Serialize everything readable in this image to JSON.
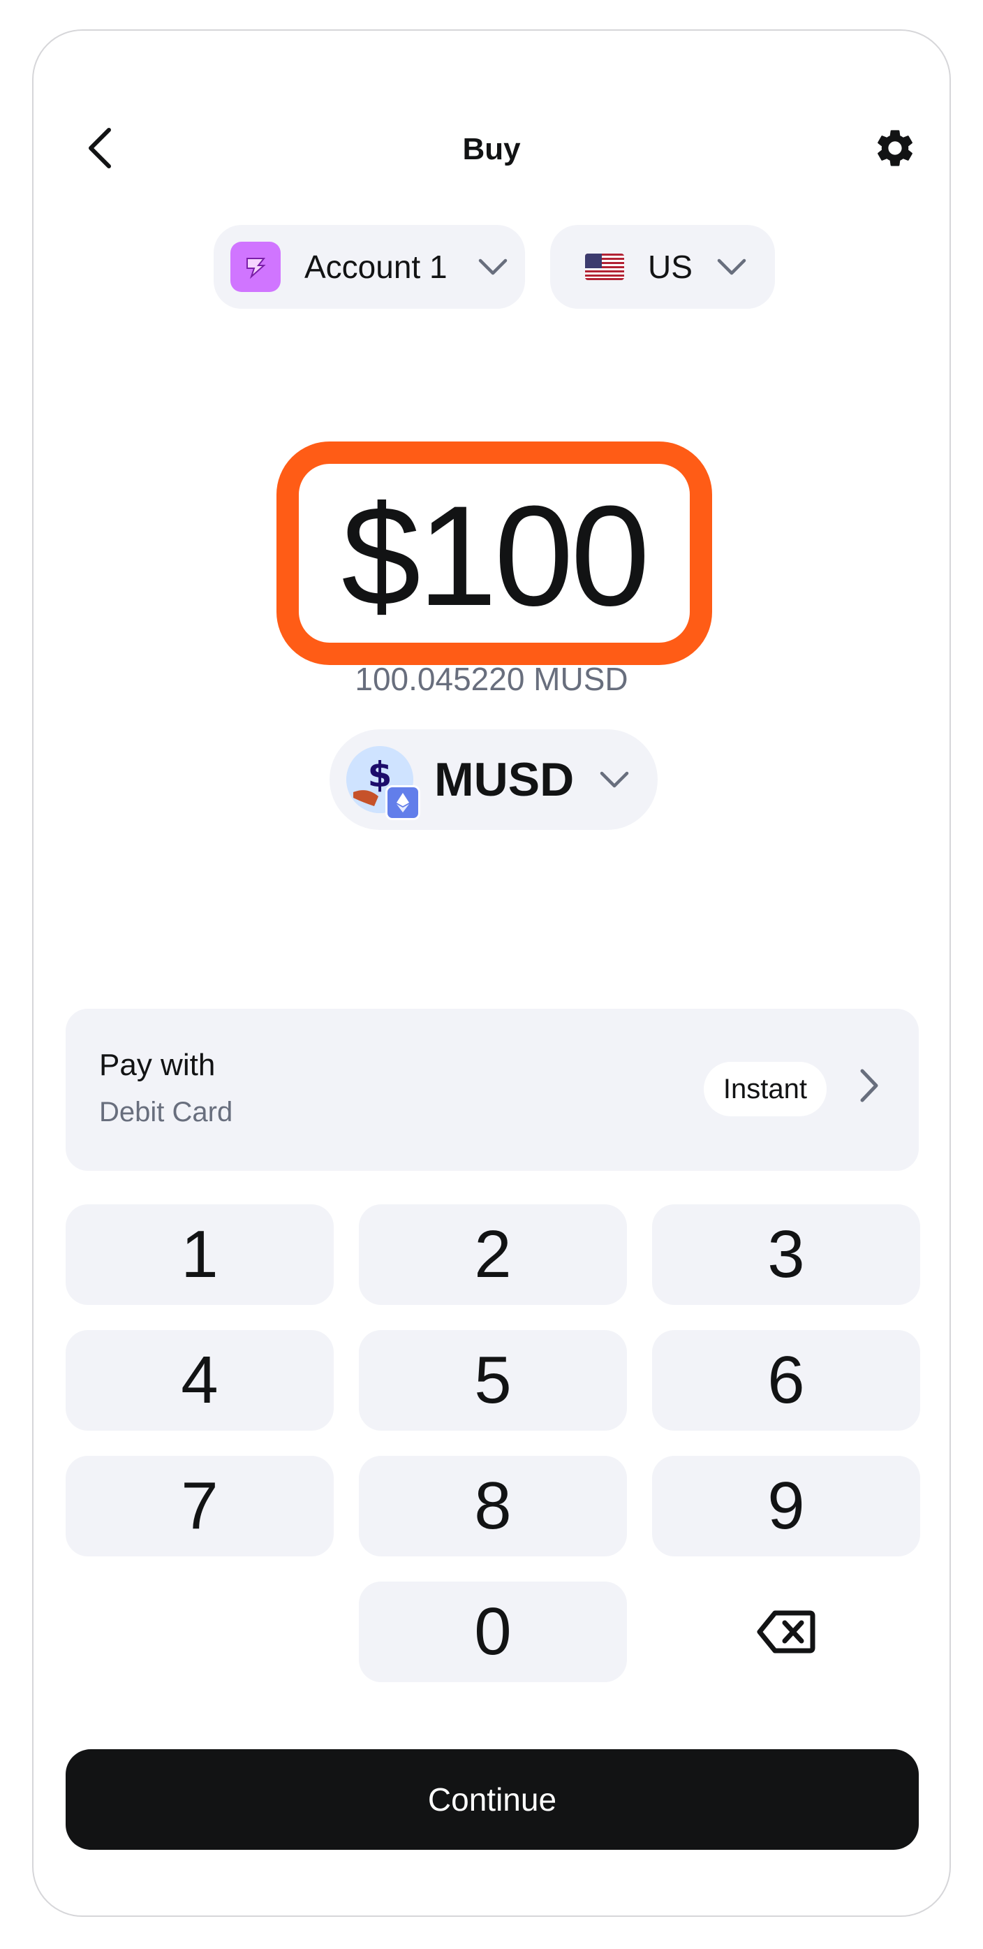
{
  "header": {
    "title": "Buy"
  },
  "selectors": {
    "account_label": "Account 1",
    "region_label": "US",
    "account_icon_color": "#d075ff"
  },
  "amount": {
    "value": "$100",
    "converted": "100.045220 MUSD",
    "highlight_color": "#ff5c16"
  },
  "token": {
    "symbol": "MUSD"
  },
  "payment": {
    "title": "Pay with",
    "method": "Debit Card",
    "speed_badge": "Instant"
  },
  "keypad": {
    "keys": [
      "1",
      "2",
      "3",
      "4",
      "5",
      "6",
      "7",
      "8",
      "9",
      "0"
    ]
  },
  "footer": {
    "continue_label": "Continue"
  },
  "icons": {
    "back": "chevron-left-icon",
    "settings": "gear-icon",
    "backspace": "backspace-icon"
  }
}
